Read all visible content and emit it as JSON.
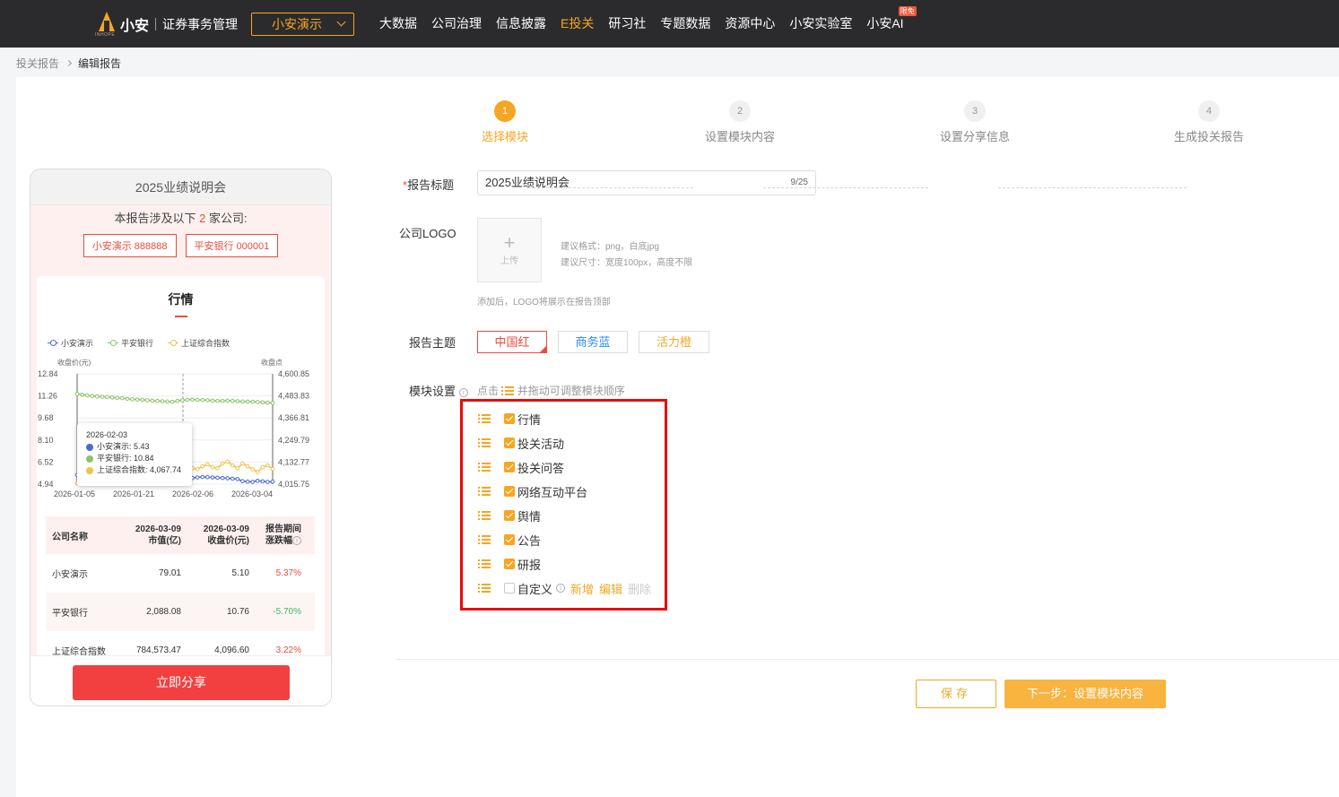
{
  "header": {
    "brand": "小安",
    "logo_sub": "INHOPE",
    "system": "证券事务管理",
    "company": "小安演示",
    "nav": [
      {
        "label": "大数据"
      },
      {
        "label": "公司治理"
      },
      {
        "label": "信息披露"
      },
      {
        "label": "E投关",
        "active": true
      },
      {
        "label": "研习社"
      },
      {
        "label": "专题数据"
      },
      {
        "label": "资源中心"
      },
      {
        "label": "小安实验室"
      },
      {
        "label": "小安AI",
        "badge": "限免"
      }
    ]
  },
  "breadcrumb": {
    "parent": "投关报告",
    "current": "编辑报告"
  },
  "preview": {
    "title": "2025业绩说明会",
    "intro_prefix": "本报告涉及以下",
    "intro_count": "2",
    "intro_suffix": "家公司:",
    "companies": [
      "小安演示 888888",
      "平安银行 000001"
    ],
    "section_title": "行情",
    "share_button": "立即分享",
    "table": {
      "headers": [
        {
          "l1": "公司名称",
          "l2": ""
        },
        {
          "l1": "2026-03-09",
          "l2": "市值(亿)"
        },
        {
          "l1": "2026-03-09",
          "l2": "收盘价(元)"
        },
        {
          "l1": "报告期间",
          "l2": "涨跌幅"
        }
      ],
      "rows": [
        {
          "name": "小安演示",
          "cap": "79.01",
          "close": "5.10",
          "change": "5.37%",
          "dir": "up"
        },
        {
          "name": "平安银行",
          "cap": "2,088.08",
          "close": "10.76",
          "change": "-5.70%",
          "dir": "down"
        },
        {
          "name": "上证综合指数",
          "cap": "784,573.47",
          "close": "4,096.60",
          "change": "3.22%",
          "dir": "up"
        }
      ]
    }
  },
  "chart_data": {
    "type": "line",
    "ylabel_left": "收盘价(元)",
    "ylabel_right": "收盘点",
    "y_ticks_left": [
      "12.84",
      "11.26",
      "9.68",
      "8.10",
      "6.52",
      "4.94"
    ],
    "y_ticks_right": [
      "4,600.85",
      "4,483.83",
      "4,366.81",
      "4,249.79",
      "4,132.77",
      "4,015.75"
    ],
    "ylim_left": [
      4.94,
      12.84
    ],
    "ylim_right": [
      4015.75,
      4600.85
    ],
    "x_ticks": [
      "2026-01-05",
      "2026-01-21",
      "2026-02-06",
      "2026-03-04"
    ],
    "legend": "top-left",
    "series": [
      {
        "name": "小安演示",
        "color": "#4b6bc9",
        "axis": "left",
        "values": [
          5.6,
          5.55,
          5.5,
          5.45,
          5.5,
          5.52,
          5.48,
          5.45,
          5.43,
          5.4,
          5.42,
          5.45,
          5.43,
          5.5,
          5.47,
          5.45,
          5.42,
          5.4,
          5.43,
          5.46,
          5.45,
          5.43,
          5.4,
          5.38,
          5.42,
          5.45,
          5.44,
          5.42,
          5.4,
          5.38,
          5.36,
          5.33,
          5.3,
          5.15,
          5.12,
          5.1,
          5.18,
          5.14,
          5.1,
          5.12
        ]
      },
      {
        "name": "平安银行",
        "color": "#8cc36a",
        "axis": "left",
        "values": [
          11.4,
          11.35,
          11.3,
          11.25,
          11.22,
          11.2,
          11.18,
          11.15,
          11.12,
          11.1,
          11.05,
          11.02,
          11.0,
          10.98,
          10.95,
          10.92,
          10.9,
          10.88,
          10.86,
          10.84,
          10.9,
          10.95,
          10.98,
          11.0,
          10.98,
          10.96,
          10.95,
          10.92,
          10.9,
          10.9,
          10.92,
          10.9,
          10.88,
          10.86,
          10.85,
          10.84,
          10.82,
          10.8,
          10.78,
          10.76
        ]
      },
      {
        "name": "上证综合指数",
        "color": "#f2c14e",
        "axis": "right",
        "values": [
          4020,
          4030,
          4040,
          4060,
          4070,
          4065,
          4075,
          4072,
          4070,
          4068,
          4066,
          4062,
          4060,
          4064,
          4067,
          4070,
          4072,
          4068,
          4070,
          4075,
          4080,
          4090,
          4095,
          4100,
          4095,
          4110,
          4120,
          4105,
          4100,
          4125,
          4135,
          4115,
          4100,
          4125,
          4110,
          4095,
          4080,
          4105,
          4115,
          4096.6
        ]
      }
    ],
    "tooltip": {
      "date": "2026-02-03",
      "items": [
        {
          "label": "小安演示: 5.43",
          "color": "#4b6bc9"
        },
        {
          "label": "平安银行: 10.84",
          "color": "#8cc36a"
        },
        {
          "label": "上证综合指数: 4,067.74",
          "color": "#f2c14e"
        }
      ]
    }
  },
  "steps": [
    {
      "num": "1",
      "label": "选择模块",
      "active": true
    },
    {
      "num": "2",
      "label": "设置模块内容"
    },
    {
      "num": "3",
      "label": "设置分享信息"
    },
    {
      "num": "4",
      "label": "生成投关报告"
    }
  ],
  "form": {
    "title_label": "报告标题",
    "title_required": "*",
    "title_value": "2025业绩说明会",
    "title_count": "9/25",
    "logo_label": "公司LOGO",
    "upload_label": "上传",
    "logo_hint_format": "建议格式：png，白底jpg",
    "logo_hint_size": "建议尺寸：宽度100px，高度不限",
    "logo_hint_after": "添加后，LOGO将展示在报告顶部",
    "theme_label": "报告主题",
    "themes": [
      "中国红",
      "商务蓝",
      "活力橙"
    ],
    "module_label": "模块设置",
    "module_hint_pre": "点击",
    "module_hint_post": "并拖动可调整模块顺序",
    "modules": [
      {
        "label": "行情",
        "checked": true
      },
      {
        "label": "投关活动",
        "checked": true
      },
      {
        "label": "投关问答",
        "checked": true
      },
      {
        "label": "网络互动平台",
        "checked": true
      },
      {
        "label": "舆情",
        "checked": true
      },
      {
        "label": "公告",
        "checked": true
      },
      {
        "label": "研报",
        "checked": true
      },
      {
        "label": "自定义",
        "checked": false
      }
    ],
    "custom_add": "新增",
    "custom_edit": "编辑",
    "custom_delete": "删除"
  },
  "actions": {
    "save": "保存",
    "next": "下一步：设置模块内容"
  },
  "colors": {
    "accent": "#f5a623",
    "red": "#e84c3d",
    "highlight_border": "#e80b0b"
  }
}
